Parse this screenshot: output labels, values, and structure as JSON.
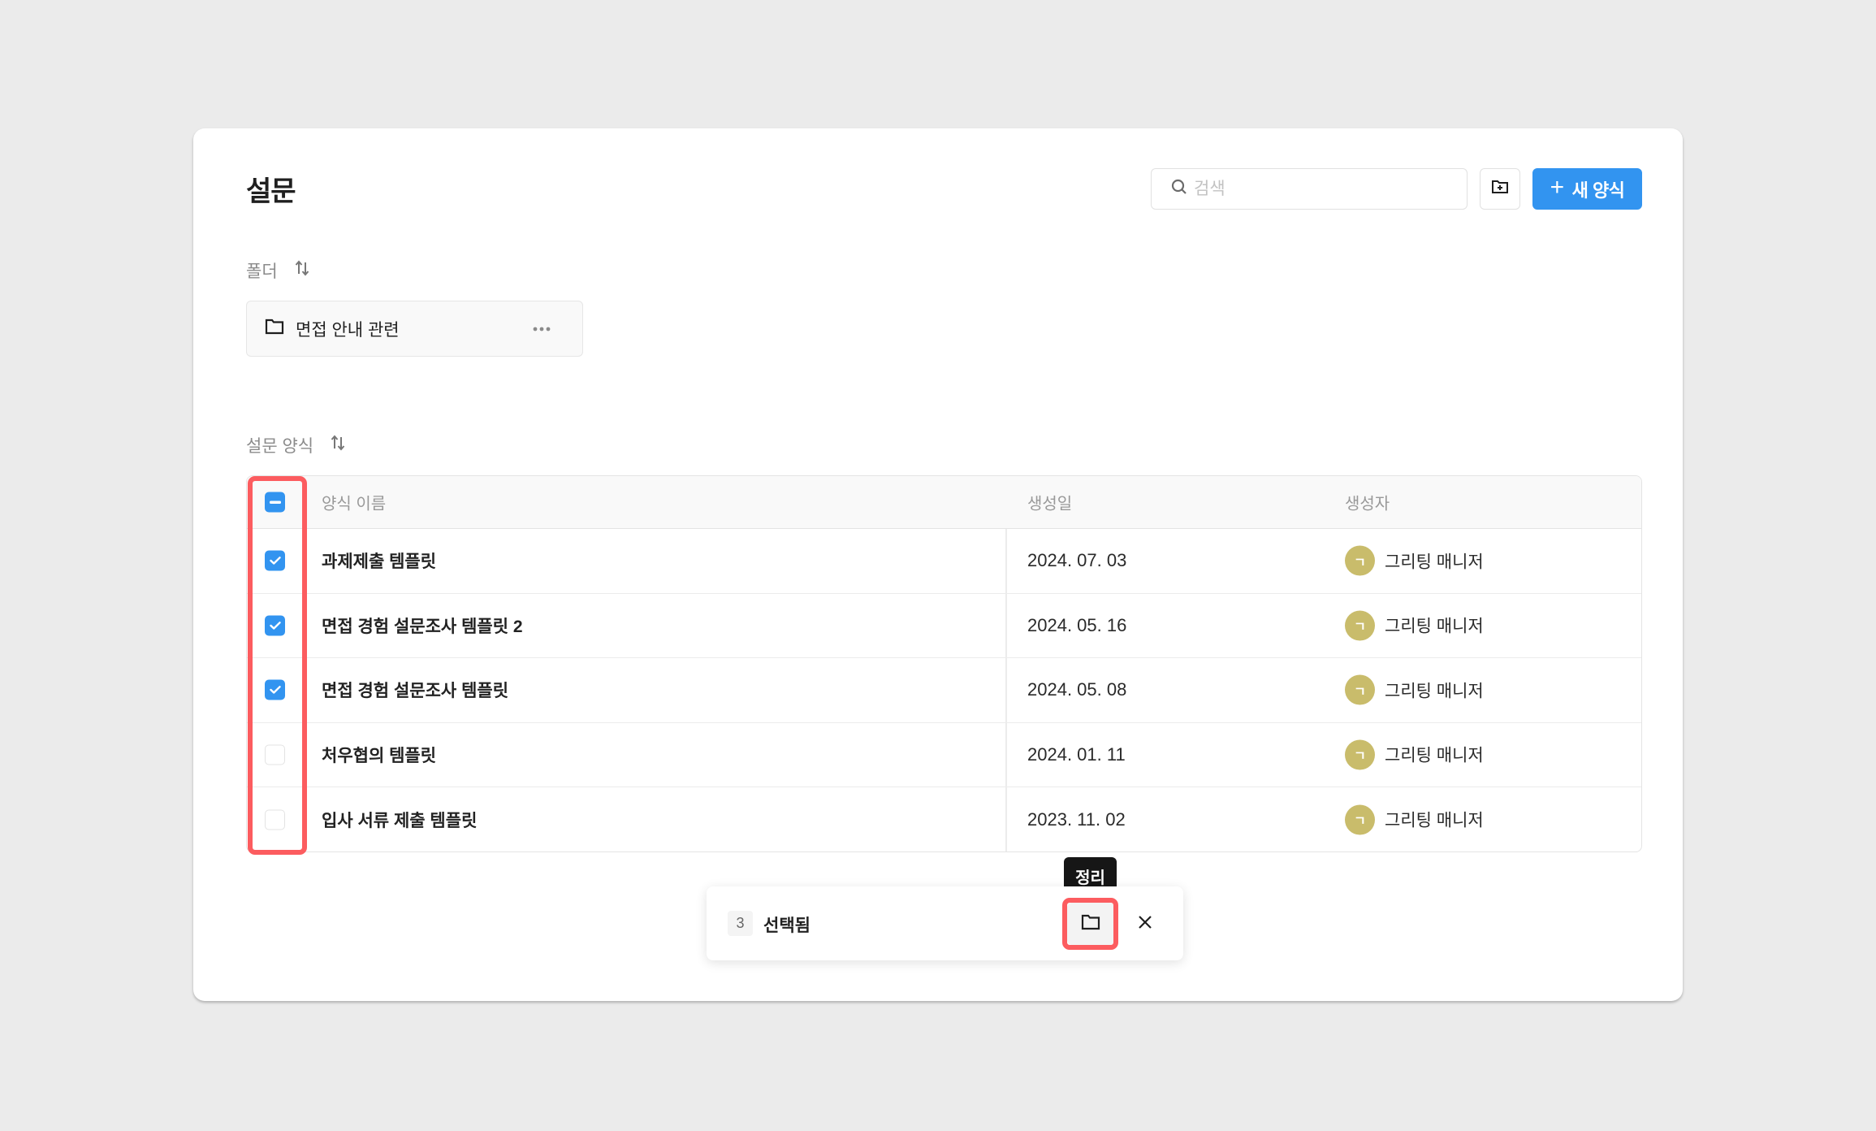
{
  "page": {
    "title": "설문"
  },
  "toolbar": {
    "search_placeholder": "검색",
    "search_value": "",
    "new_folder_icon": "folder-plus-icon",
    "new_form_label": "새 양식",
    "new_form_icon": "plus-icon"
  },
  "folders": {
    "label": "폴더",
    "sort_icon": "sort-arrows-icon",
    "items": [
      {
        "name": "면접 안내 관련",
        "icon": "folder-icon",
        "menu_icon": "more-horizontal-icon"
      }
    ]
  },
  "forms": {
    "label": "설문 양식",
    "sort_icon": "sort-arrows-icon",
    "columns": {
      "name": "양식 이름",
      "date": "생성일",
      "author": "생성자"
    },
    "header_checkbox_state": "indeterminate",
    "rows": [
      {
        "name": "과제제출 템플릿",
        "date": "2024. 07. 03",
        "author": "그리팅 매니저",
        "avatar_initial": "ㄱ",
        "checked": true
      },
      {
        "name": "면접 경험 설문조사 템플릿 2",
        "date": "2024. 05. 16",
        "author": "그리팅 매니저",
        "avatar_initial": "ㄱ",
        "checked": true
      },
      {
        "name": "면접 경험 설문조사 템플릿",
        "date": "2024. 05. 08",
        "author": "그리팅 매니저",
        "avatar_initial": "ㄱ",
        "checked": true
      },
      {
        "name": "처우협의 템플릿",
        "date": "2024. 01. 11",
        "author": "그리팅 매니저",
        "avatar_initial": "ㄱ",
        "checked": false
      },
      {
        "name": "입사 서류 제출 템플릿",
        "date": "2023. 11. 02",
        "author": "그리팅 매니저",
        "avatar_initial": "ㄱ",
        "checked": false
      }
    ]
  },
  "selection_bar": {
    "count": "3",
    "label": "선택됨",
    "organize_icon": "folder-icon",
    "organize_tooltip": "정리",
    "close_icon": "close-icon"
  },
  "colors": {
    "accent": "#3294f0",
    "highlight": "#fc5c5f",
    "avatar": "#c9bc6b",
    "background": "#ebebeb"
  }
}
